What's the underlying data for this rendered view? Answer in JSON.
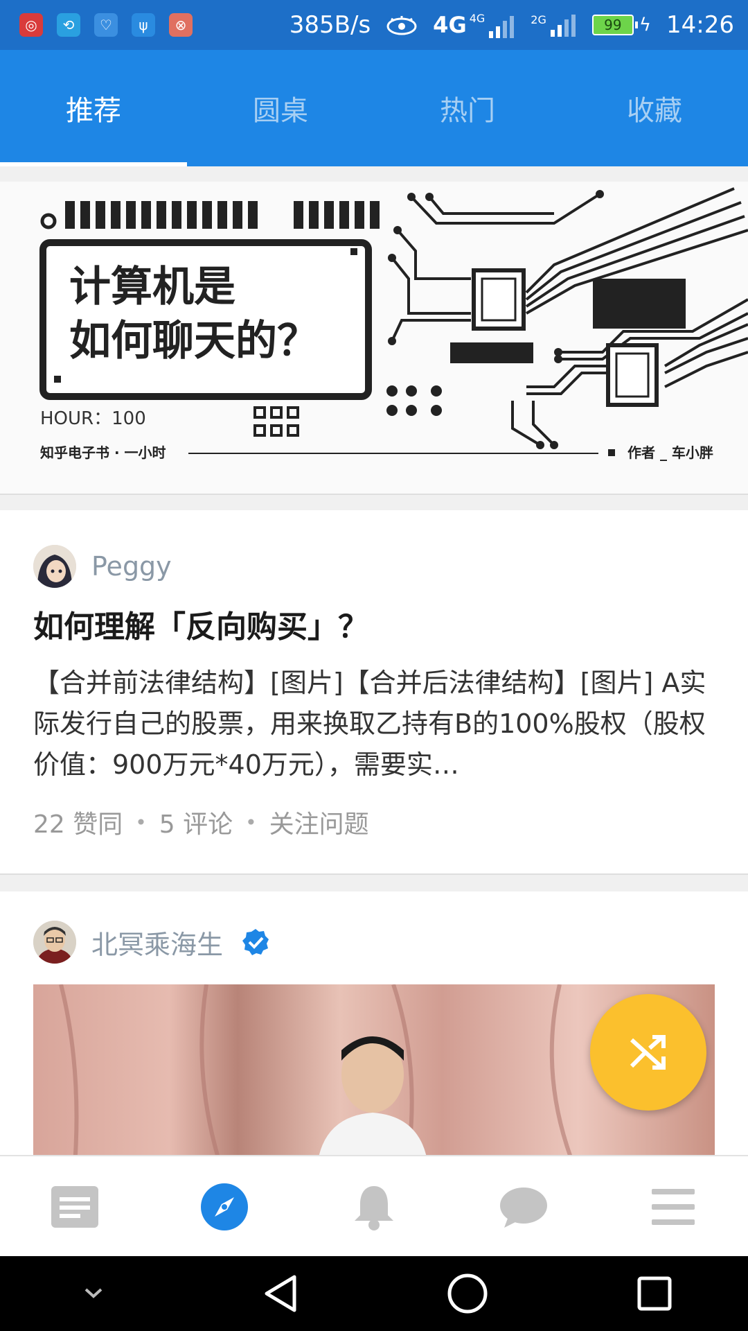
{
  "status_bar": {
    "network_speed": "385B/s",
    "signal1_label": "4G",
    "signal1_sub": "4G",
    "signal2_label": "2G",
    "battery": "99",
    "time": "14:26",
    "app_icons": [
      "netease-music-icon",
      "sync-icon",
      "health-icon",
      "usb-icon",
      "app-icon"
    ]
  },
  "tabs": [
    {
      "label": "推荐",
      "active": true
    },
    {
      "label": "圆桌",
      "active": false
    },
    {
      "label": "热门",
      "active": false
    },
    {
      "label": "收藏",
      "active": false
    }
  ],
  "banner": {
    "title_line1": "计算机是",
    "title_line2": "如何聊天的？",
    "hour_label": "HOUR：100",
    "publisher": "知乎电子书 · 一小时",
    "author": "作者 _ 车小胖"
  },
  "feed": [
    {
      "author": "Peggy",
      "title": "如何理解「反向购买」？",
      "excerpt": "【合并前法律结构】[图片]【合并后法律结构】[图片] A实际发行自己的股票，用来换取乙持有B的100%股权（股权价值：900万元*40万元），需要实…",
      "likes": "22 赞同",
      "comments": "5 评论",
      "follow": "关注问题"
    },
    {
      "author": "北冥乘海生",
      "verified": true
    }
  ],
  "fab": {
    "icon": "shuffle-icon",
    "color": "#fbc02d"
  },
  "bottom_nav": [
    {
      "icon": "feed-icon",
      "active": false
    },
    {
      "icon": "explore-icon",
      "active": true
    },
    {
      "icon": "bell-icon",
      "active": false
    },
    {
      "icon": "chat-icon",
      "active": false
    },
    {
      "icon": "menu-icon",
      "active": false
    }
  ],
  "system_nav": [
    "collapse-icon",
    "back-icon",
    "home-icon",
    "recents-icon"
  ],
  "colors": {
    "primary": "#1e86e5",
    "status_bar": "#1d6fc8",
    "accent": "#fbc02d"
  }
}
